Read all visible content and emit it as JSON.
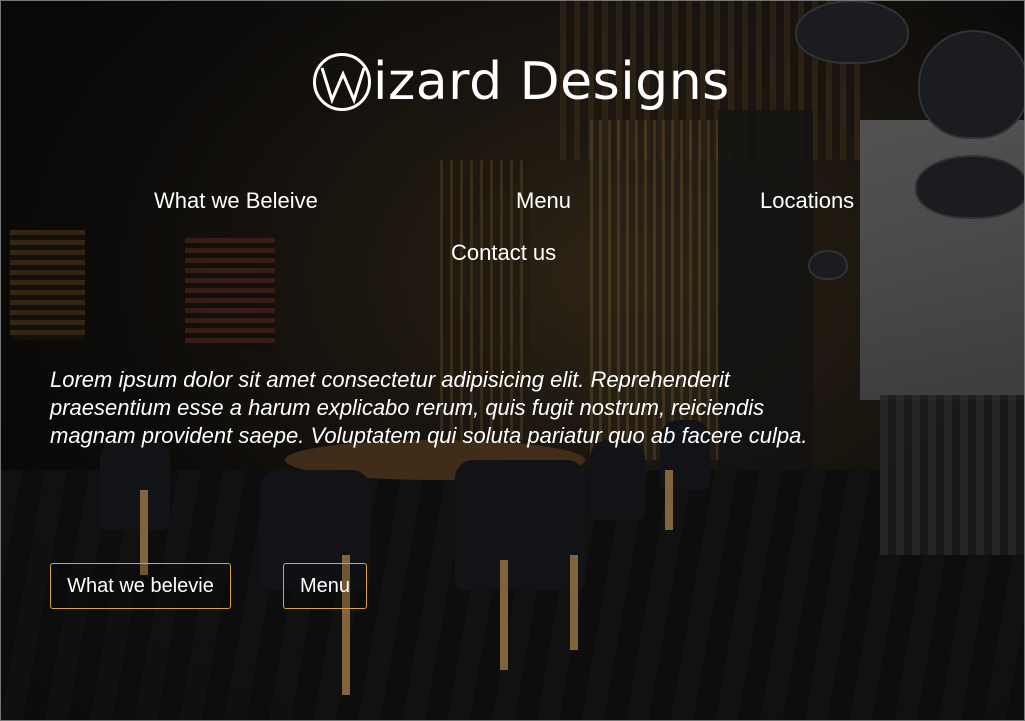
{
  "brand": {
    "logo_letter": "W",
    "name": "izard Designs"
  },
  "nav": {
    "items": [
      {
        "label": "What we Beleive"
      },
      {
        "label": "Menu"
      },
      {
        "label": "Locations"
      },
      {
        "label": "Contact us"
      }
    ]
  },
  "hero": {
    "intro": "Lorem ipsum dolor sit amet consectetur adipisicing elit. Reprehenderit praesentium esse a harum explicabo rerum, quis fugit nostrum, reiciendis magnam provident saepe. Voluptatem qui soluta pariatur quo ab facere culpa.",
    "background_image": "restaurant interior"
  },
  "buttons": {
    "primary_label": "What we belevie",
    "secondary_label": "Menu"
  },
  "colors": {
    "text": "#ffffff",
    "button_border": "#d7a441"
  },
  "icons": {
    "logo": "w-circle-logo-icon"
  }
}
